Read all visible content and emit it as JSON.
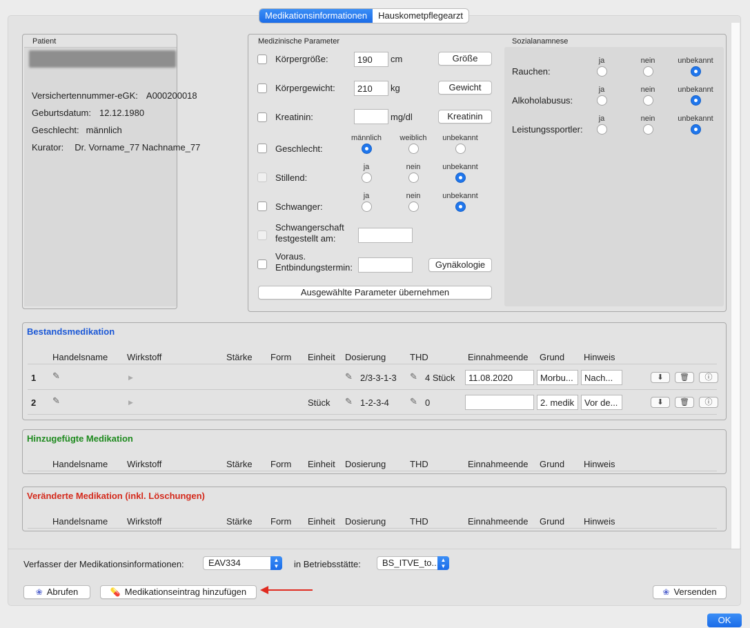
{
  "tabs": [
    {
      "label": "Medikationsinformationen",
      "active": true
    },
    {
      "label": "Hauskometpflegearzt",
      "active": false
    }
  ],
  "patient": {
    "title": "Patient",
    "fields": [
      {
        "label": "Versichertennummer-eGK:",
        "value": "A000200018"
      },
      {
        "label": "Geburtsdatum:",
        "value": "12.12.1980"
      },
      {
        "label": "Geschlecht:",
        "value": "männlich"
      },
      {
        "label": "Kurator:",
        "value": "Dr. Vorname_77 Nachname_77"
      }
    ]
  },
  "med_params": {
    "title": "Medizinische Parameter",
    "groesse": {
      "label": "Körpergröße:",
      "value": "190",
      "unit": "cm",
      "button": "Größe"
    },
    "gewicht": {
      "label": "Körpergewicht:",
      "value": "210",
      "unit": "kg",
      "button": "Gewicht"
    },
    "kreatinin": {
      "label": "Kreatinin:",
      "value": "",
      "unit": "mg/dl",
      "button": "Kreatinin"
    },
    "geschlecht": {
      "label": "Geschlecht:",
      "options": [
        "männlich",
        "weiblich",
        "unbekannt"
      ],
      "selected": "männlich"
    },
    "stillend": {
      "label": "Stillend:",
      "options": [
        "ja",
        "nein",
        "unbekannt"
      ],
      "selected": "unbekannt"
    },
    "schwanger": {
      "label": "Schwanger:",
      "options": [
        "ja",
        "nein",
        "unbekannt"
      ],
      "selected": "unbekannt"
    },
    "schwangerschaft_line1": "Schwangerschaft",
    "schwangerschaft_line2": "festgestellt am:",
    "entbindung_line1": "Voraus.",
    "entbindung_line2": "Entbindungstermin:",
    "gyn_button": "Gynäkologie",
    "apply_button": "Ausgewählte Parameter übernehmen"
  },
  "sozial": {
    "title": "Sozialanamnese",
    "options": [
      "ja",
      "nein",
      "unbekannt"
    ],
    "rows": [
      {
        "label": "Rauchen:",
        "selected": "unbekannt"
      },
      {
        "label": "Alkoholabusus:",
        "selected": "unbekannt"
      },
      {
        "label": "Leistungssportler:",
        "selected": "unbekannt"
      }
    ]
  },
  "columns": [
    "Handelsname",
    "Wirkstoff",
    "Stärke",
    "Form",
    "Einheit",
    "Dosierung",
    "THD",
    "Einnahmeende",
    "Grund",
    "Hinweis"
  ],
  "bestand": {
    "title": "Bestandsmedikation",
    "color": "#1a57d6",
    "rows": [
      {
        "num": "1",
        "einheit": "",
        "dosierung": "2/3-3-1-3",
        "thd": "4 Stück",
        "einnahmeende": "11.08.2020",
        "grund": "Morbu...",
        "hinweis": "Nach..."
      },
      {
        "num": "2",
        "einheit": "Stück",
        "dosierung": "1-2-3-4",
        "thd": "0",
        "einnahmeende": "",
        "grund": "2. medik",
        "hinweis": "Vor de..."
      }
    ]
  },
  "hinzu": {
    "title": "Hinzugefügte Medikation",
    "color": "#1e8a1e"
  },
  "veraendert": {
    "title": "Veränderte Medikation (inkl. Löschungen)",
    "color": "#d42a1c"
  },
  "footer": {
    "verfasser_label": "Verfasser der Medikationsinformationen:",
    "verfasser_value": "EAV334",
    "betrieb_label": "in Betriebsstätte:",
    "betrieb_value": "BS_ITVE_to...",
    "abrufen": "Abrufen",
    "hinzufuegen": "Medikationseintrag hinzufügen",
    "versenden": "Versenden",
    "ok": "OK"
  }
}
